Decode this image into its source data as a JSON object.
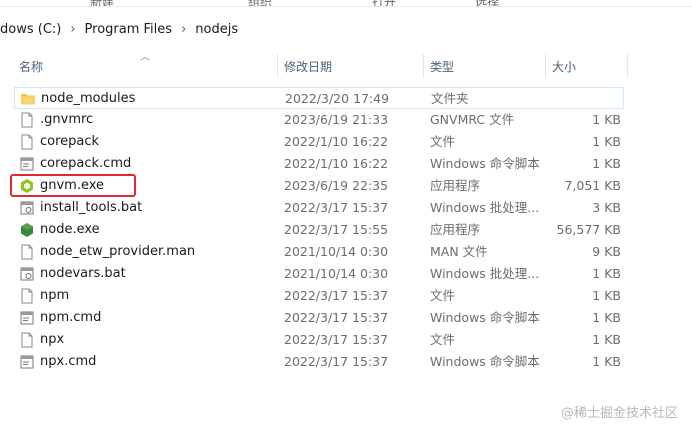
{
  "ribbon": {
    "items": [
      "选择",
      "打开",
      "新建",
      "组织"
    ]
  },
  "address": {
    "crumbs": [
      "dows (C:)",
      "Program Files",
      "nodejs"
    ]
  },
  "columns": {
    "name": "名称",
    "modified": "修改日期",
    "type": "类型",
    "size": "大小"
  },
  "files": [
    {
      "name": "node_modules",
      "modified": "2022/3/20 17:49",
      "type": "文件夹",
      "size": "",
      "icon": "folder-icon"
    },
    {
      "name": ".gnvmrc",
      "modified": "2023/6/19 21:33",
      "type": "GNVMRC 文件",
      "size": "1 KB",
      "icon": "file-icon"
    },
    {
      "name": "corepack",
      "modified": "2022/1/10 16:22",
      "type": "文件",
      "size": "1 KB",
      "icon": "file-icon"
    },
    {
      "name": "corepack.cmd",
      "modified": "2022/1/10 16:22",
      "type": "Windows 命令脚本",
      "size": "1 KB",
      "icon": "script-file-icon"
    },
    {
      "name": "gnvm.exe",
      "modified": "2023/6/19 22:35",
      "type": "应用程序",
      "size": "7,051 KB",
      "icon": "gnvm-app-icon"
    },
    {
      "name": "install_tools.bat",
      "modified": "2022/3/17 15:37",
      "type": "Windows 批处理...",
      "size": "3 KB",
      "icon": "batch-file-icon"
    },
    {
      "name": "node.exe",
      "modified": "2022/3/17 15:55",
      "type": "应用程序",
      "size": "56,577 KB",
      "icon": "node-app-icon"
    },
    {
      "name": "node_etw_provider.man",
      "modified": "2021/10/14 0:30",
      "type": "MAN 文件",
      "size": "9 KB",
      "icon": "file-icon"
    },
    {
      "name": "nodevars.bat",
      "modified": "2021/10/14 0:30",
      "type": "Windows 批处理...",
      "size": "1 KB",
      "icon": "batch-file-icon"
    },
    {
      "name": "npm",
      "modified": "2022/3/17 15:37",
      "type": "文件",
      "size": "1 KB",
      "icon": "file-icon"
    },
    {
      "name": "npm.cmd",
      "modified": "2022/3/17 15:37",
      "type": "Windows 命令脚本",
      "size": "1 KB",
      "icon": "script-file-icon"
    },
    {
      "name": "npx",
      "modified": "2022/3/17 15:37",
      "type": "文件",
      "size": "1 KB",
      "icon": "file-icon"
    },
    {
      "name": "npx.cmd",
      "modified": "2022/3/17 15:37",
      "type": "Windows 命令脚本",
      "size": "1 KB",
      "icon": "script-file-icon"
    }
  ],
  "watermark": "@稀土掘金技术社区",
  "colors": {
    "highlight": "#e0282e",
    "node_green": "#3c873a",
    "folder_yellow": "#f4c542"
  }
}
